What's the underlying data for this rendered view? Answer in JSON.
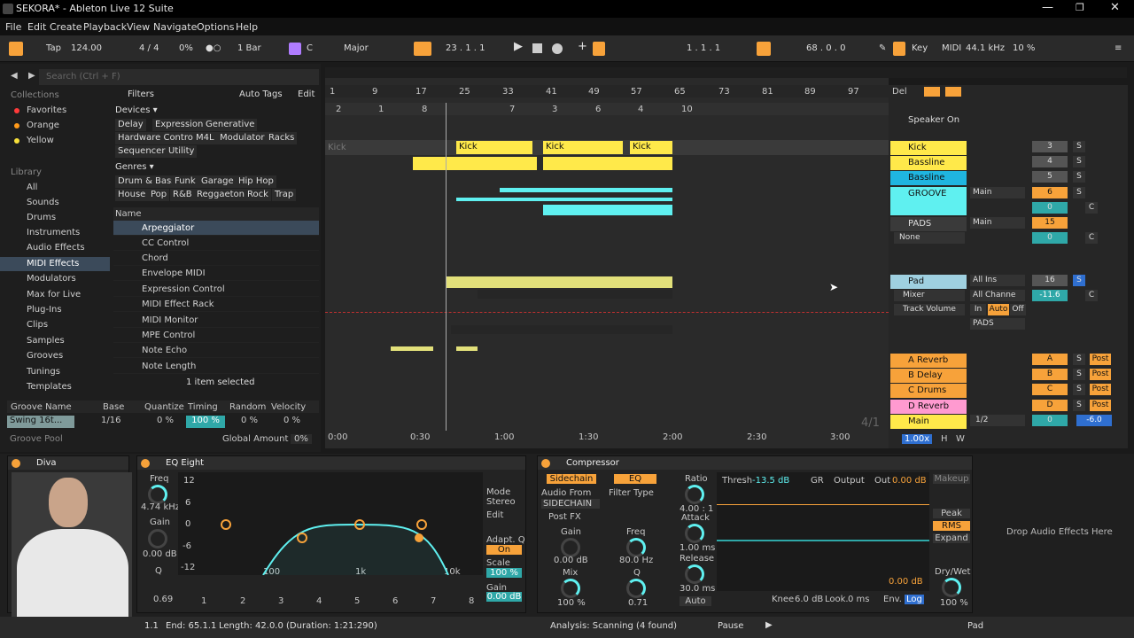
{
  "window": {
    "title": "SEKORA* - Ableton Live 12 Suite"
  },
  "menu": [
    "File",
    "Edit",
    "Create",
    "Playback",
    "View",
    "Navigate",
    "Options",
    "Help"
  ],
  "transport": {
    "tap": "Tap",
    "tempo": "124.00",
    "signature": "4 / 4",
    "groove": "0%",
    "quantize": "1 Bar",
    "key_root": "C",
    "scale": "Major",
    "position": "23 .  1 .  1",
    "loop_start": "1 .  1 .  1",
    "loop_length": "68 .  0 .  0",
    "key": "Key",
    "midi": "MIDI",
    "sample_rate": "44.1 kHz",
    "cpu": "10 %"
  },
  "browser": {
    "search_placeholder": "Search (Ctrl + F)",
    "collections_title": "Collections",
    "collections": [
      {
        "name": "Favorites",
        "color": "#ff3a3a"
      },
      {
        "name": "Orange",
        "color": "#ff9a1a"
      },
      {
        "name": "Yellow",
        "color": "#f7e03a"
      }
    ],
    "library_title": "Library",
    "library": [
      "All",
      "Sounds",
      "Drums",
      "Instruments",
      "Audio Effects",
      "MIDI Effects",
      "Modulators",
      "Max for Live",
      "Plug-Ins",
      "Clips",
      "Samples",
      "Grooves",
      "Tunings",
      "Templates"
    ],
    "filters": "Filters",
    "auto_tags": "Auto Tags",
    "edit": "Edit",
    "devices_title": "Devices ▾",
    "device_tags": [
      "Delay",
      "Expression",
      "Generative",
      "Hardware Control",
      "M4L",
      "Modulator",
      "Racks",
      "Sequencer",
      "Utility"
    ],
    "genres_title": "Genres ▾",
    "genre_tags": [
      "Drum & Bass",
      "Funk",
      "Garage",
      "Hip Hop",
      "House",
      "Pop",
      "R&B",
      "Reggaeton",
      "Rock",
      "Trap"
    ],
    "name_col": "Name",
    "items": [
      "Arpeggiator",
      "CC Control",
      "Chord",
      "Envelope MIDI",
      "Expression Control",
      "MIDI Effect Rack",
      "MIDI Monitor",
      "MPE Control",
      "Note Echo",
      "Note Length"
    ],
    "selected": "1 item selected",
    "groove_headers": [
      "Groove Name",
      "Base",
      "Quantize",
      "Timing",
      "Random",
      "Velocity"
    ],
    "groove_values": [
      "Swing 16t...",
      "1/16",
      "0 %",
      "100 %",
      "0 %",
      "0 %"
    ],
    "groove_pool": "Groove Pool",
    "global_amount": "Global Amount",
    "global_value": "0%"
  },
  "arrangement": {
    "ruler": [
      "1",
      "9",
      "17",
      "25",
      "33",
      "41",
      "49",
      "57",
      "65",
      "73",
      "81",
      "89",
      "97"
    ],
    "locators": [
      "2",
      "1",
      "8",
      "7",
      "3",
      "6",
      "4",
      "10"
    ],
    "time": [
      "0:00",
      "0:30",
      "1:00",
      "1:30",
      "2:00",
      "2:30",
      "3:00"
    ],
    "kick_track": "Kick",
    "clip_kick": "Kick",
    "zoom_label": "4/1"
  },
  "mixer": {
    "del": "Del",
    "tracks": [
      {
        "name": "Speaker On",
        "color": "#f7e03a"
      },
      {
        "name": "Kick",
        "color": "#ffe94a",
        "num": "3"
      },
      {
        "name": "Bassline",
        "color": "#ffe94a",
        "num": "4"
      },
      {
        "name": "Bassline",
        "color": "#1fb5e0",
        "num": "5"
      },
      {
        "name": "GROOVE",
        "color": "#5ff0f0",
        "num": "6",
        "route": "Main"
      },
      {
        "name": "PADS",
        "color": "#e2e07a",
        "num": "15",
        "route": "Main"
      },
      {
        "name": "Pad",
        "color": "#9fd0e0",
        "num": "16",
        "route": "All Ins"
      }
    ],
    "none": "None",
    "mixer_label": "Mixer",
    "track_volume": "Track Volume",
    "all_channels": "All Channe",
    "pads": "PADS",
    "in": "In",
    "auto": "Auto",
    "off": "Off",
    "vol_pad": "-11.6",
    "inf": "-∞",
    "returns": [
      {
        "name": "A Reverb",
        "letter": "A"
      },
      {
        "name": "B Delay",
        "letter": "B"
      },
      {
        "name": "C Drums Room",
        "letter": "C"
      },
      {
        "name": "D Reverb",
        "letter": "D"
      }
    ],
    "main": "Main",
    "main_route": "1/2",
    "main_vol": "-6.0",
    "post": "Post",
    "s": "S",
    "c": "C",
    "zero": "0",
    "h": "H",
    "w": "W",
    "zoom": "1.00x"
  },
  "devices": {
    "diva": "Diva",
    "eq": {
      "title": "EQ Eight",
      "freq_label": "Freq",
      "freq": "4.74 kHz",
      "gain_label": "Gain",
      "gain": "0.00 dB",
      "q_label": "Q",
      "q": "0.69",
      "mode_label": "Mode",
      "mode": "Stereo",
      "edit": "Edit",
      "adapt_q": "Adapt. Q",
      "on": "On",
      "scale_label": "Scale",
      "scale": "100 %",
      "gain2_label": "Gain",
      "gain2": "0.00 dB",
      "db_labels": [
        "12",
        "6",
        "0",
        "-6",
        "-12"
      ],
      "freq_labels": [
        "100",
        "1k",
        "10k"
      ],
      "bands": [
        "1",
        "2",
        "3",
        "4",
        "5",
        "6",
        "7",
        "8"
      ]
    },
    "comp": {
      "title": "Compressor",
      "sidechain": "Sidechain",
      "eq_btn": "EQ",
      "audio_from": "Audio From",
      "source": "SIDECHAIN",
      "post_fx": "Post FX",
      "filter_type": "Filter Type",
      "gain_label": "Gain",
      "gain": "0.00 dB",
      "freq_label": "Freq",
      "freq": "80.0 Hz",
      "mix_label": "Mix",
      "mix": "100 %",
      "q_label": "Q",
      "q": "0.71",
      "ratio_label": "Ratio",
      "ratio": "4.00 : 1",
      "attack_label": "Attack",
      "attack": "1.00 ms",
      "release_label": "Release",
      "release": "30.0 ms",
      "auto": "Auto",
      "thresh_label": "Thresh",
      "thresh": "-13.5 dB",
      "gr": "GR",
      "output": "Output",
      "out_label": "Out",
      "out": "0.00 dB",
      "makeup": "Makeup",
      "peak": "Peak",
      "rms": "RMS",
      "expand": "Expand",
      "knee_label": "Knee",
      "knee": "6.0 dB",
      "look_label": "Look.",
      "look": "0 ms",
      "env": "Env.",
      "log": "Log",
      "graph_val": "0.00 dB",
      "drywet_label": "Dry/Wet",
      "drywet": "100 %"
    },
    "drop": "Drop Audio Effects Here"
  },
  "status": {
    "start": "1.1",
    "end": "End: 65.1.1",
    "length": "Length: 42.0.0 (Duration: 1:21:290)",
    "analysis": "Analysis: Scanning (4 found)",
    "pause": "Pause",
    "track": "Pad"
  }
}
